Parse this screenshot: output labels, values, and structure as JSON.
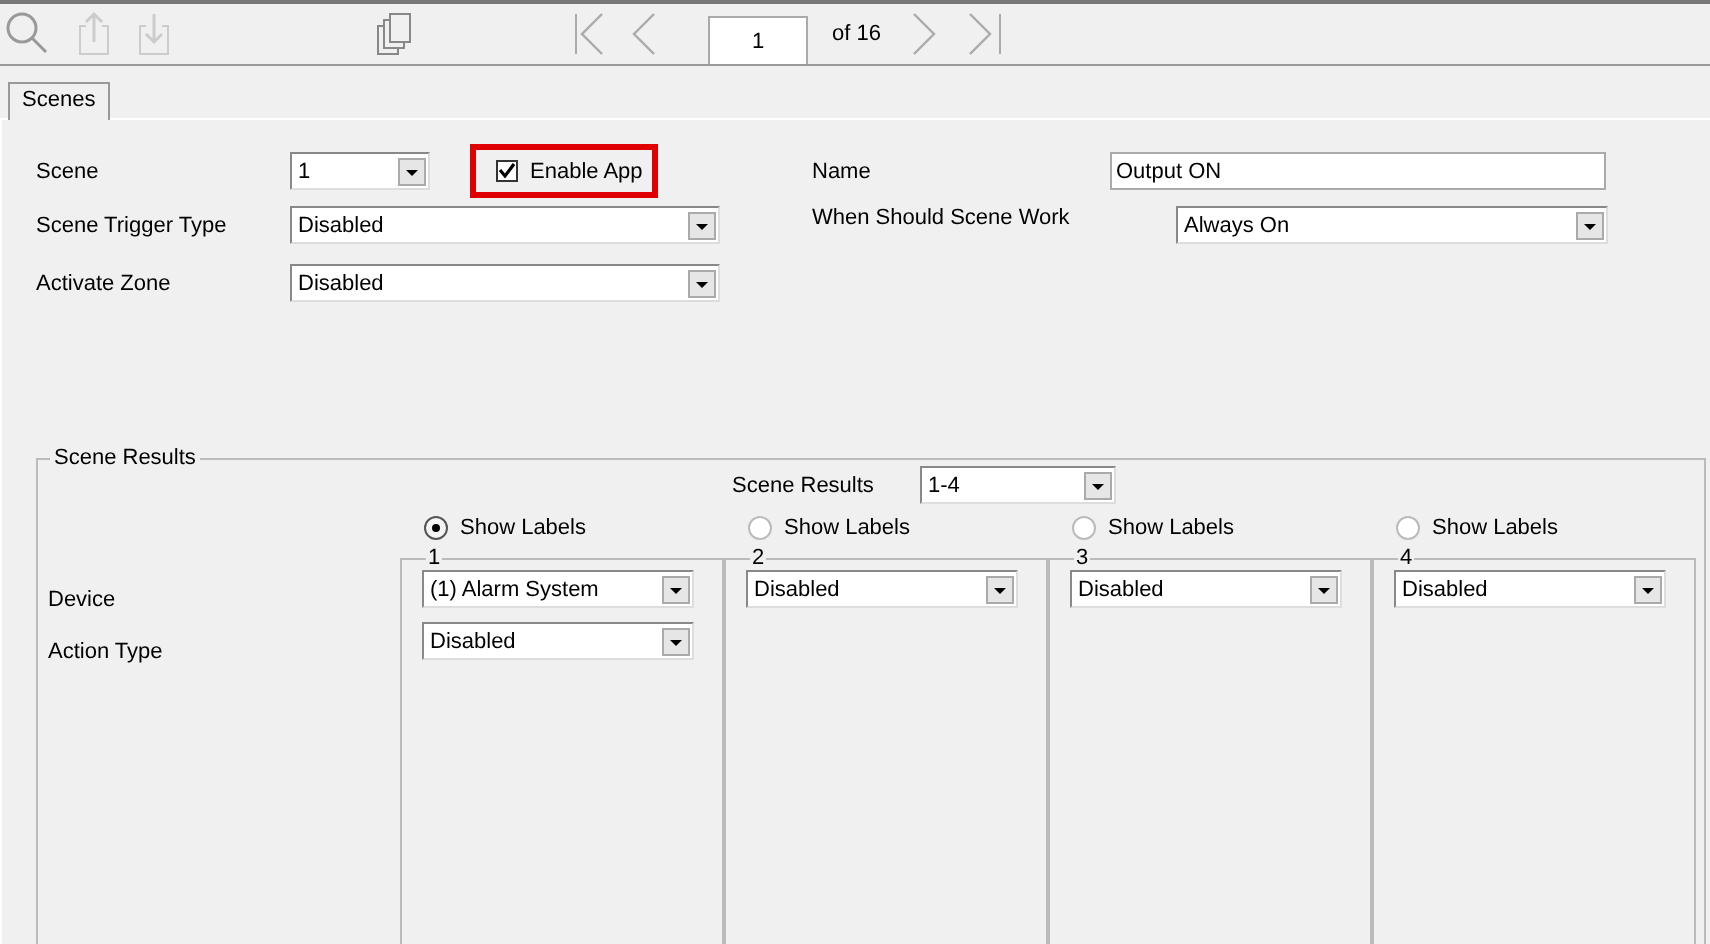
{
  "toolbar": {
    "page": "1",
    "page_count": "of 16"
  },
  "tabs": [
    {
      "label": "Scenes",
      "selected": true
    }
  ],
  "form": {
    "scene": {
      "label": "Scene",
      "value": "1"
    },
    "enable_app": {
      "label": "Enable App",
      "checked": true,
      "highlighted": true
    },
    "name": {
      "label": "Name",
      "value": "Output ON"
    },
    "trigger_type": {
      "label": "Scene Trigger Type",
      "value": "Disabled"
    },
    "when_work": {
      "label": "When Should Scene Work",
      "value": "Always On"
    },
    "activate_zone": {
      "label": "Activate Zone",
      "value": "Disabled"
    }
  },
  "scene_results": {
    "title": "Scene Results",
    "range_label": "Scene Results",
    "range_value": "1-4",
    "row_labels": [
      "Device",
      "Action Type"
    ],
    "columns": [
      {
        "number": "1",
        "show_labels": {
          "label": "Show Labels",
          "selected": true
        },
        "fields": [
          "(1) Alarm System",
          "Disabled"
        ]
      },
      {
        "number": "2",
        "show_labels": {
          "label": "Show Labels",
          "selected": false
        },
        "fields": [
          "Disabled"
        ]
      },
      {
        "number": "3",
        "show_labels": {
          "label": "Show Labels",
          "selected": false
        },
        "fields": [
          "Disabled"
        ]
      },
      {
        "number": "4",
        "show_labels": {
          "label": "Show Labels",
          "selected": false
        },
        "fields": [
          "Disabled"
        ]
      }
    ]
  }
}
